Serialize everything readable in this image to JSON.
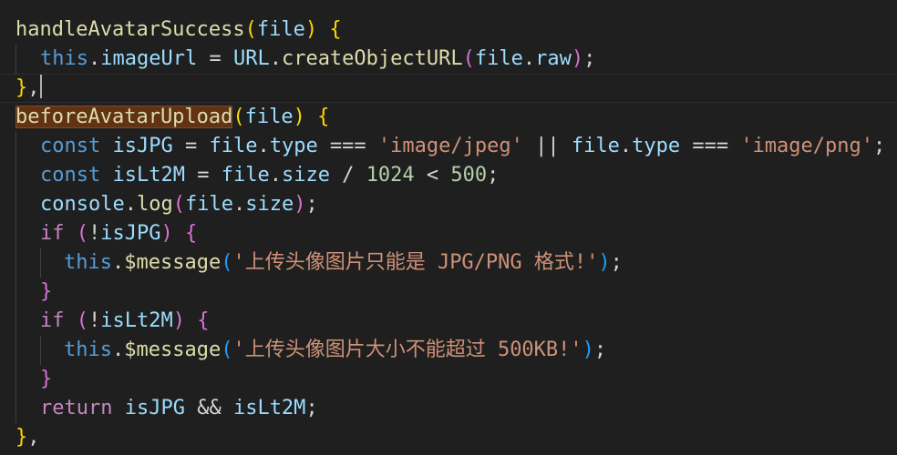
{
  "code": {
    "l1": {
      "fn": "handleAvatarSuccess",
      "open": "(",
      "param": "file",
      "close": ")",
      "sp": " ",
      "brace": "{"
    },
    "l2": {
      "this": "this",
      "dot1": ".",
      "prop": "imageUrl",
      "eq": " = ",
      "cls": "URL",
      "dot2": ".",
      "fn": "createObjectURL",
      "open": "(",
      "obj": "file",
      "dot3": ".",
      "raw": "raw",
      "close": ")",
      "semi": ";"
    },
    "l3": {
      "brace": "}",
      "comma": ","
    },
    "l4": {
      "fn": "beforeAvatarUpload",
      "open": "(",
      "param": "file",
      "close": ")",
      "sp": " ",
      "brace": "{"
    },
    "l5": {
      "kw": "const",
      "sp1": " ",
      "name": "isJPG",
      "eq": " = ",
      "obj1": "file",
      "dot1": ".",
      "prop1": "type",
      "op1": " === ",
      "str1": "'image/jpeg'",
      "or": " || ",
      "obj2": "file",
      "dot2": ".",
      "prop2": "type",
      "op2": " === ",
      "str2": "'image/png'",
      "semi": ";"
    },
    "l6": {
      "kw": "const",
      "sp1": " ",
      "name": "isLt2M",
      "eq": " = ",
      "obj": "file",
      "dot": ".",
      "prop": "size",
      "div": " / ",
      "num1": "1024",
      "lt": " < ",
      "num2": "500",
      "semi": ";"
    },
    "l7": {
      "obj": "console",
      "dot1": ".",
      "fn": "log",
      "open": "(",
      "arg": "file",
      "dot2": ".",
      "prop": "size",
      "close": ")",
      "semi": ";"
    },
    "l8": {
      "kw": "if",
      "sp": " ",
      "open": "(",
      "not": "!",
      "name": "isJPG",
      "close": ")",
      "sp2": " ",
      "brace": "{"
    },
    "l9": {
      "this": "this",
      "dot": ".",
      "fn": "$message",
      "open": "(",
      "str": "'上传头像图片只能是 JPG/PNG 格式!'",
      "close": ")",
      "semi": ";"
    },
    "l10": {
      "brace": "}"
    },
    "l11": {
      "kw": "if",
      "sp": " ",
      "open": "(",
      "not": "!",
      "name": "isLt2M",
      "close": ")",
      "sp2": " ",
      "brace": "{"
    },
    "l12": {
      "this": "this",
      "dot": ".",
      "fn": "$message",
      "open": "(",
      "str": "'上传头像图片大小不能超过 500KB!'",
      "close": ")",
      "semi": ";"
    },
    "l13": {
      "brace": "}"
    },
    "l14": {
      "kw": "return",
      "sp": " ",
      "a": "isJPG",
      "and": " && ",
      "b": "isLt2M",
      "semi": ";"
    },
    "l15": {
      "brace": "}",
      "comma": ","
    }
  },
  "colors": {
    "background": "#1f1f1f",
    "function": "#dcdcaa",
    "keyword": "#569cd6",
    "control": "#c586c0",
    "variable": "#9cdcfe",
    "class": "#4ec9b0",
    "string": "#ce9178",
    "number": "#b5cea8",
    "bracket_level1": "#ffd700",
    "bracket_level2": "#da70d6",
    "bracket_level3": "#179fff",
    "selection_highlight": "#613214"
  }
}
